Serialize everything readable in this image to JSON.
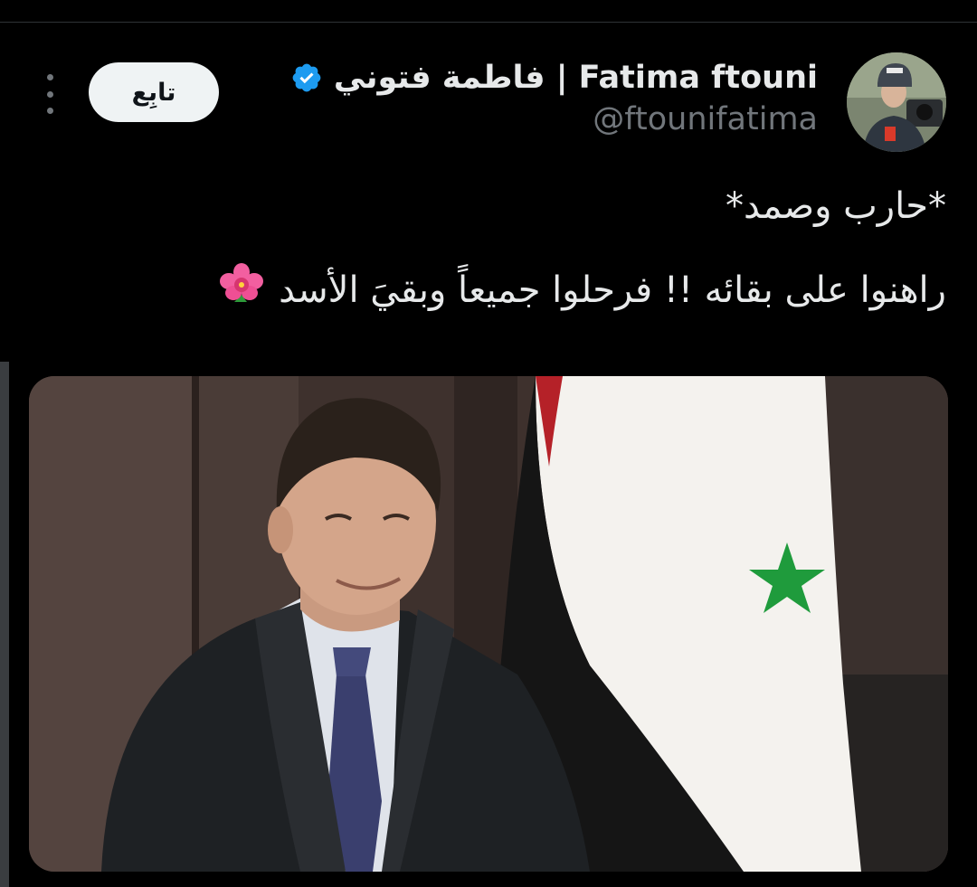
{
  "tweet": {
    "author": {
      "display_name": "فاطمة فتوني | Fatima ftouni",
      "handle": "@ftounifatima",
      "verified": true,
      "avatar_icon": "user-avatar-photo"
    },
    "follow_label": "تابِع",
    "text_lines": [
      "*حارب وصمد*",
      "راهنوا على بقائه !! فرحلوا جميعاً وبقيَ الأسد"
    ],
    "emoji_icon": "hibiscus-icon",
    "media_icon": "photo-image"
  },
  "colors": {
    "background": "#000000",
    "text_primary": "#e7e9ea",
    "text_secondary": "#71767b",
    "verified_blue": "#1d9bf0",
    "follow_button_bg": "#eff3f4",
    "follow_button_text": "#0f1419"
  }
}
